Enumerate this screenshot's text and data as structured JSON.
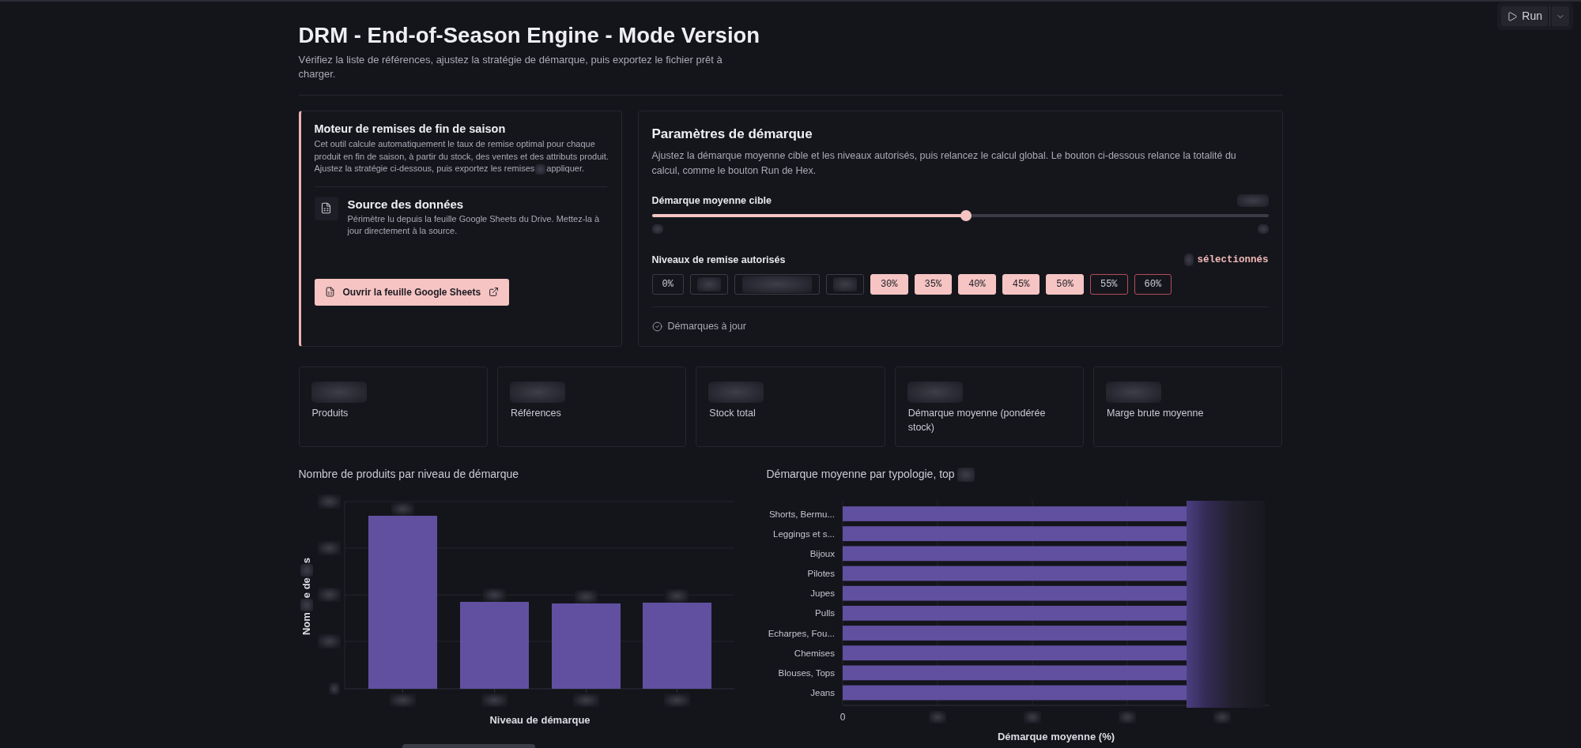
{
  "run_button": {
    "label": "Run"
  },
  "header": {
    "title": "DRM - End-of-Season Engine - Mode Version",
    "subtitle": "Vérifiez la liste de références, ajustez la stratégie de démarque, puis exportez le fichier prêt à charger."
  },
  "intro_card": {
    "title": "Moteur de remises de fin de saison",
    "description_parts": [
      "Cet outil calcule automatiquement le taux de remise optimal pour chaque produit en fin de saison, à partir du stock, des ventes et des attributs produit. Ajustez la stratégie ci-dessous, puis exportez les remises",
      "appliquer."
    ],
    "source": {
      "title": "Source des données",
      "description": "Périmètre lu depuis la feuille Google Sheets du Drive. Mettez-la à jour directement à la source."
    },
    "button": {
      "label": "Ouvrir la feuille Google Sheets"
    }
  },
  "params_card": {
    "title": "Paramètres de démarque",
    "description": "Ajustez la démarque moyenne cible et les niveaux autorisés, puis relancez le calcul global. Le bouton ci-dessous relance la totalité du calcul, comme le bouton Run de Hex.",
    "slider": {
      "label": "Démarque moyenne cible",
      "level": 0.51,
      "value_blurred": true,
      "range_blurred": true
    },
    "levels": {
      "label": "Niveaux de remise autorisés",
      "count_blurred": true,
      "count_suffix": "sélectionnés",
      "chips": [
        {
          "kind": "text",
          "label": "0%",
          "selected": false,
          "warning": false
        },
        {
          "kind": "blurred",
          "selected": false,
          "warning": false
        },
        {
          "kind": "blurred_wide",
          "selected": false,
          "warning": false
        },
        {
          "kind": "blurred",
          "selected": false,
          "warning": false
        },
        {
          "kind": "text",
          "label": "30%",
          "selected": true,
          "warning": false
        },
        {
          "kind": "text",
          "label": "35%",
          "selected": true,
          "warning": false
        },
        {
          "kind": "text",
          "label": "40%",
          "selected": true,
          "warning": false
        },
        {
          "kind": "text",
          "label": "45%",
          "selected": true,
          "warning": false
        },
        {
          "kind": "text",
          "label": "50%",
          "selected": true,
          "warning": false
        },
        {
          "kind": "text",
          "label": "55%",
          "selected": false,
          "warning": true
        },
        {
          "kind": "text",
          "label": "60%",
          "selected": false,
          "warning": true
        }
      ]
    },
    "status": {
      "label": "Démarques à jour"
    }
  },
  "kpis": [
    {
      "label": "Produits",
      "value_blurred": true
    },
    {
      "label": "Références",
      "value_blurred": true
    },
    {
      "label": "Stock total",
      "value_blurred": true
    },
    {
      "label": "Démarque moyenne (pondérée stock)",
      "value_blurred": true
    },
    {
      "label": "Marge brute moyenne",
      "value_blurred": true
    }
  ],
  "chart_by_level": {
    "title": "Nombre de produits par niveau de démarque",
    "xlabel": "Niveau de démarque",
    "ylabel_parts": [
      "Nom",
      "e de",
      "s"
    ],
    "labels_blurred": true
  },
  "chart_by_type": {
    "title": "Démarque moyenne par typologie, top",
    "title_suffix_blurred": true,
    "categories": [
      "Shorts, Bermu...",
      "Leggings et s...",
      "Bijoux",
      "Pilotes",
      "Jupes",
      "Pulls",
      "Echarpes, Fou...",
      "Chemises",
      "Blouses, Tops",
      "Jeans"
    ],
    "first_xtick": "0",
    "xticks_blurred": true,
    "end_blurred": true,
    "xlabel": "Démarque moyenne (%)"
  }
}
